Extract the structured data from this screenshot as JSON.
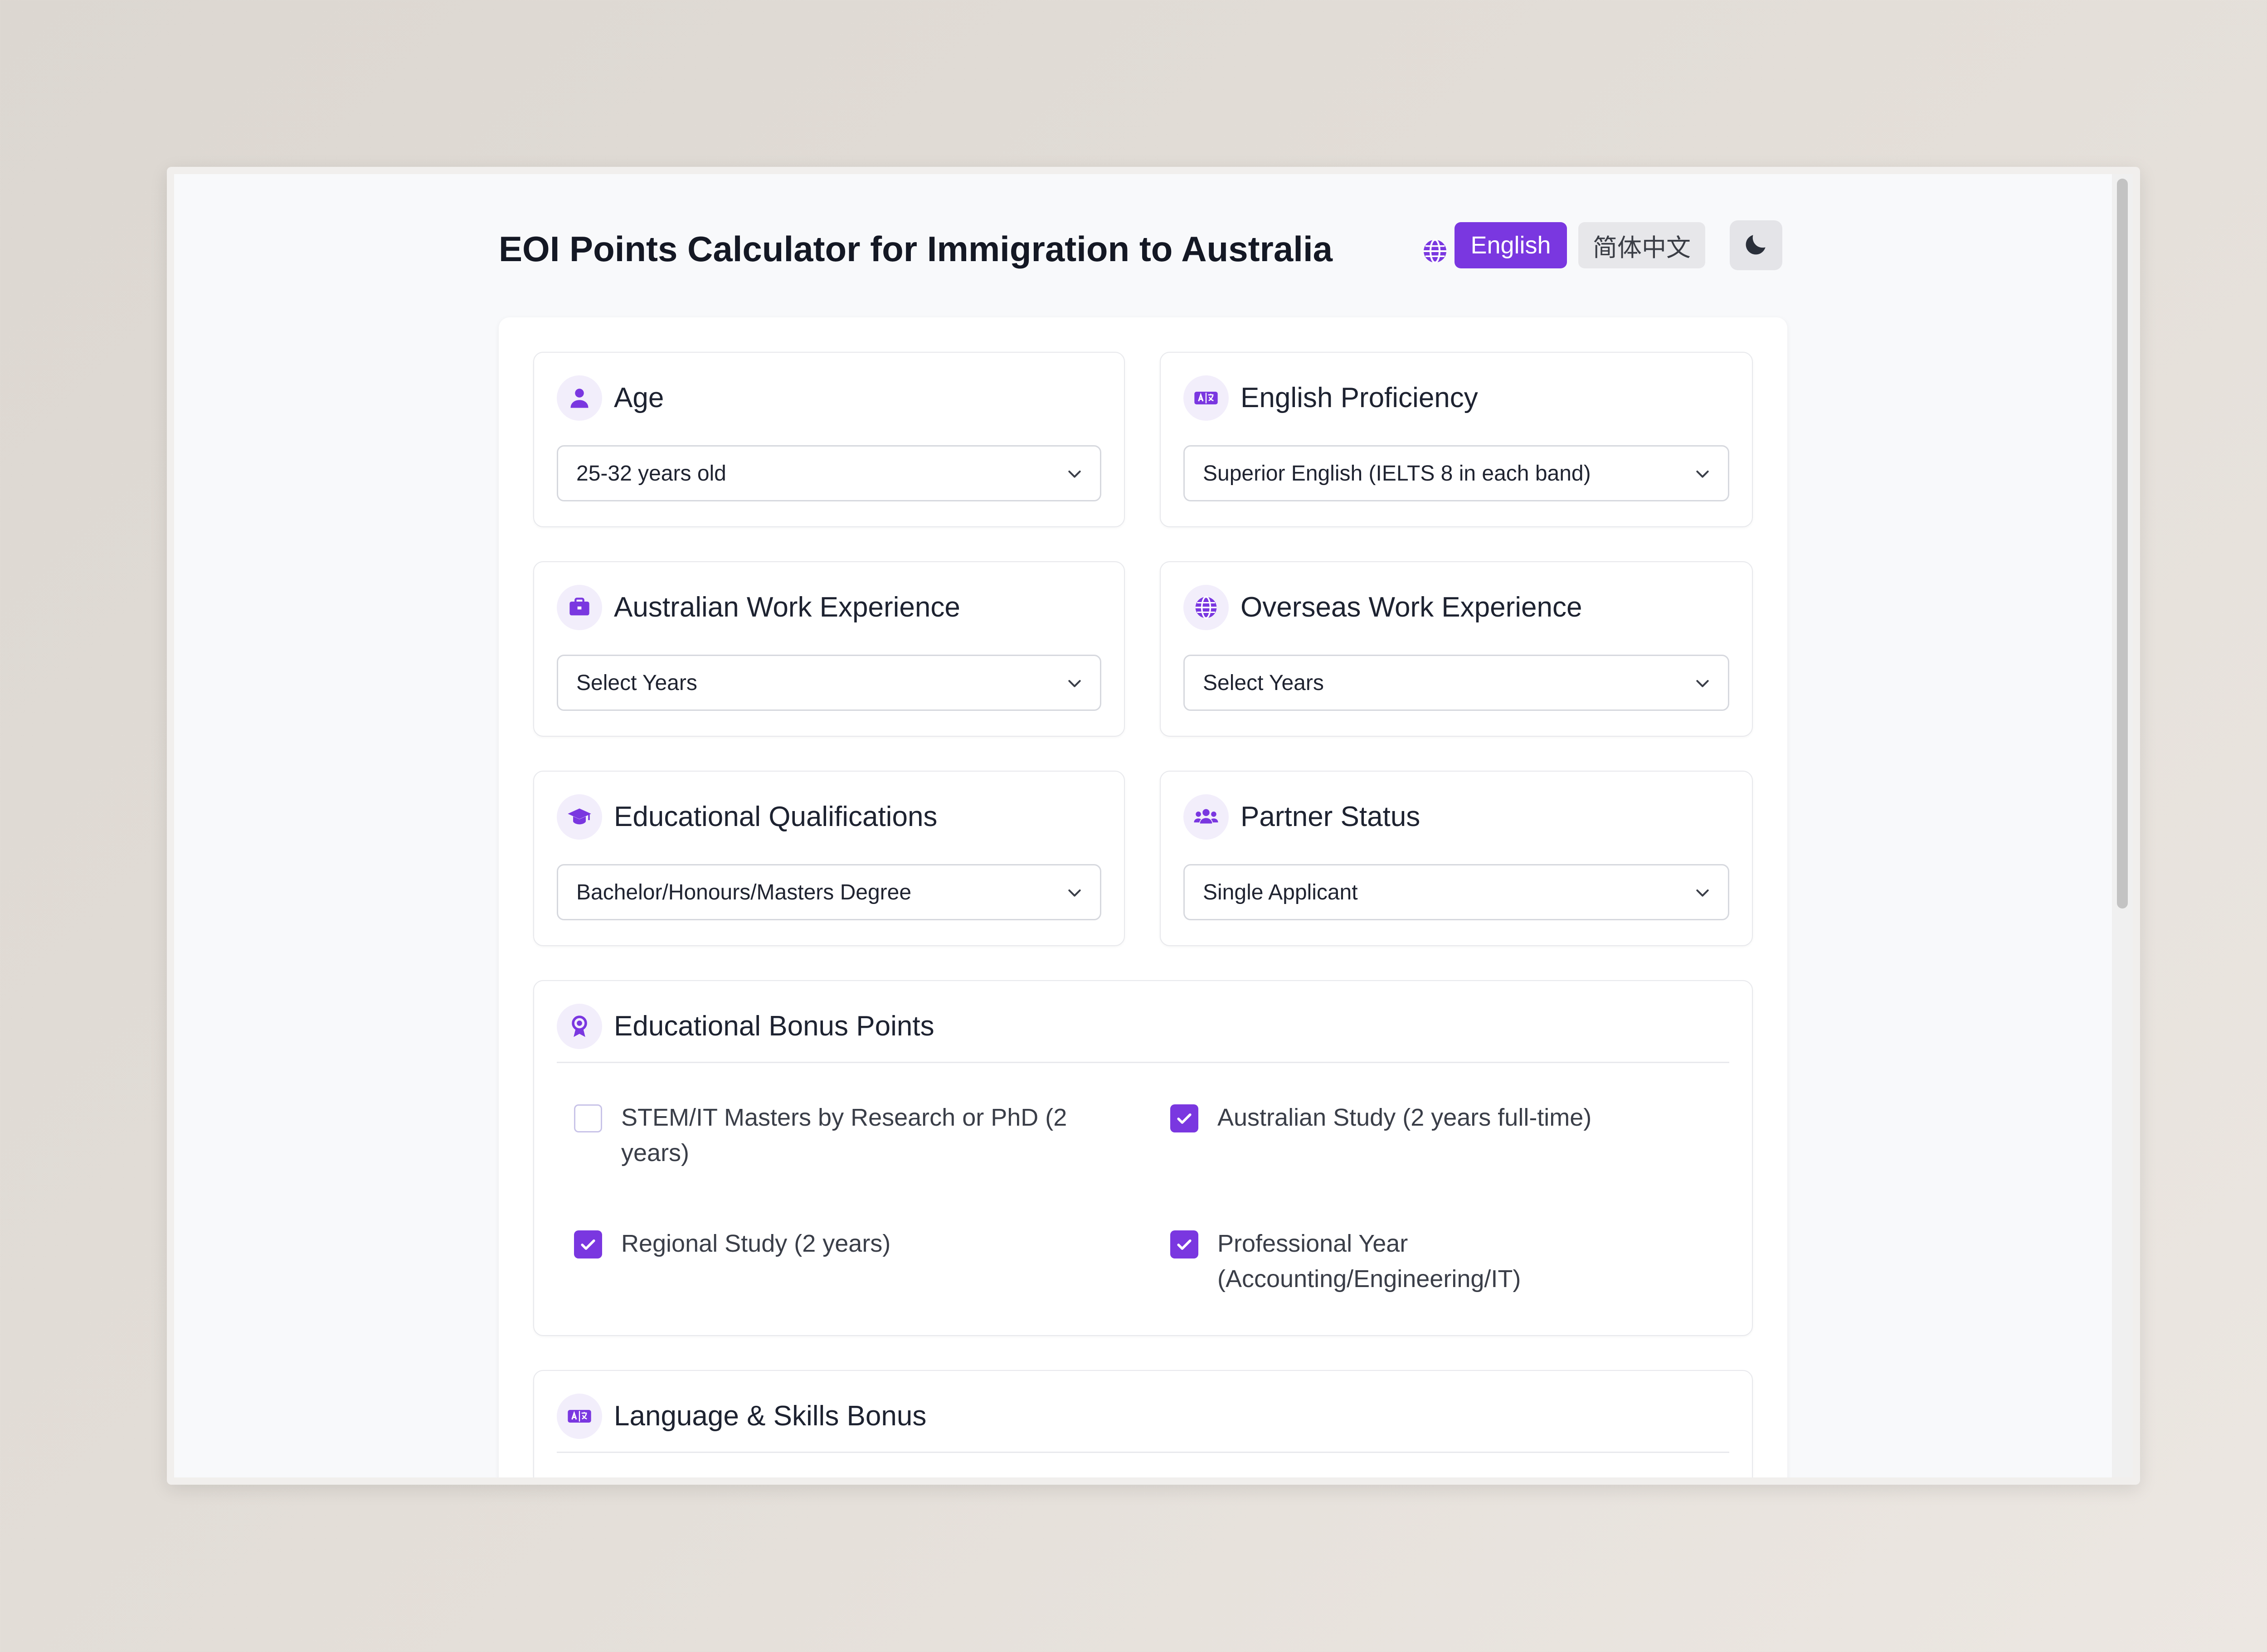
{
  "header": {
    "title": "EOI Points Calculator for Immigration to Australia",
    "lang_english": "English",
    "lang_chinese": "简体中文"
  },
  "cards": {
    "age": {
      "title": "Age",
      "value": "25-32 years old",
      "icon": "user-icon"
    },
    "english": {
      "title": "English Proficiency",
      "value": "Superior English (IELTS 8 in each band)",
      "icon": "language-icon"
    },
    "au_work": {
      "title": "Australian Work Experience",
      "value": "Select Years",
      "icon": "briefcase-icon"
    },
    "os_work": {
      "title": "Overseas Work Experience",
      "value": "Select Years",
      "icon": "globe-icon"
    },
    "education": {
      "title": "Educational Qualifications",
      "value": "Bachelor/Honours/Masters Degree",
      "icon": "graduation-cap-icon"
    },
    "partner": {
      "title": "Partner Status",
      "value": "Single Applicant",
      "icon": "users-icon"
    }
  },
  "bonus": {
    "title": "Educational Bonus Points",
    "icon": "award-icon",
    "items": [
      {
        "label": "STEM/IT Masters by Research or PhD (2 years)",
        "checked": false
      },
      {
        "label": "Australian Study (2 years full-time)",
        "checked": true
      },
      {
        "label": "Regional Study (2 years)",
        "checked": true
      },
      {
        "label": "Professional Year (Accounting/Engineering/IT)",
        "checked": true
      }
    ]
  },
  "language_bonus": {
    "title": "Language & Skills Bonus",
    "icon": "language-icon"
  },
  "colors": {
    "accent": "#7a37e0",
    "accent_light": "#f2eefb",
    "text": "#141824"
  }
}
